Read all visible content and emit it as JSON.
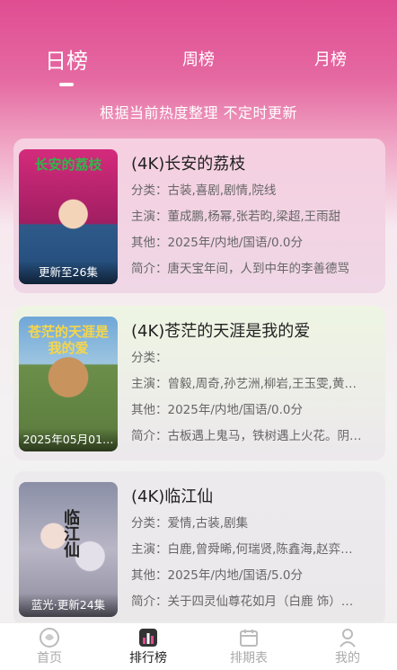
{
  "tabs": {
    "daily": "日榜",
    "weekly": "周榜",
    "monthly": "月榜"
  },
  "subtitle": "根据当前热度整理 不定时更新",
  "items": [
    {
      "title": "(4K)长安的荔枝",
      "genre": "分类：古装,喜剧,剧情,院线",
      "cast": "主演：董成鹏,杨幂,张若昀,梁超,王雨甜",
      "other": "其他：2025年/内地/国语/0.0分",
      "intro": "简介：唐天宝年间，人到中年的李善德骂",
      "badge": "更新至26集",
      "poster_text": "长安的荔枝"
    },
    {
      "title": "(4K)苍茫的天涯是我的爱",
      "genre": "分类：",
      "cast": "主演：曾毅,周奇,孙艺洲,柳岩,王玉雯,黄…",
      "other": "其他：2025年/内地/国语/0.0分",
      "intro": "简介：古板遇上鬼马，铁树遇上火花。阴…",
      "badge": "2025年05月01…",
      "poster_text": "苍茫的天涯是我的爱"
    },
    {
      "title": "(4K)临江仙",
      "genre": "分类：爱情,古装,剧集",
      "cast": "主演：白鹿,曾舜晞,何瑞贤,陈鑫海,赵弈…",
      "other": "其他：2025年/内地/国语/5.0分",
      "intro": "简介：关于四灵仙尊花如月（白鹿 饰）…",
      "badge": "蓝光·更新24集",
      "poster_text": "临江仙"
    }
  ],
  "nav": {
    "home": "首页",
    "ranking": "排行榜",
    "schedule": "排期表",
    "mine": "我的"
  },
  "colors": {
    "accent": "#e04d92",
    "active_nav": "#222222",
    "inactive_nav": "#aaaaaa"
  },
  "icons": {
    "home": "home-icon",
    "ranking": "ranking-icon",
    "schedule": "calendar-icon",
    "mine": "user-icon"
  }
}
